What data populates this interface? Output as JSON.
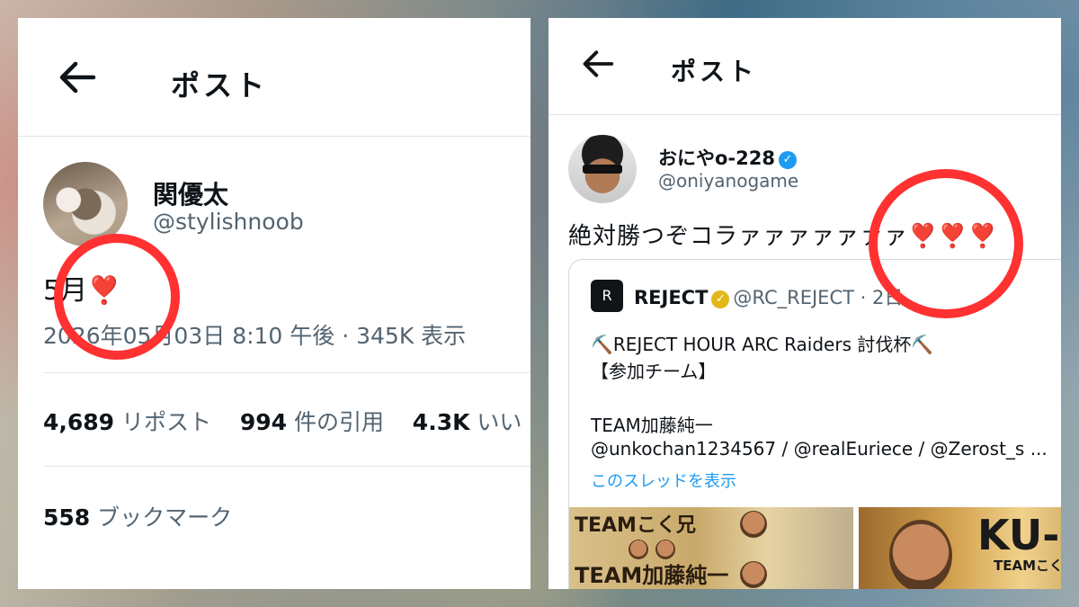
{
  "left_post": {
    "header_title": "ポスト",
    "author_name": "関優太",
    "author_handle": "@stylishnoob",
    "text": "5月",
    "emoji": "❣️",
    "meta": "2026年05月03日 8:10 午後 · 345K 表示",
    "stats": {
      "reposts_count": "4,689",
      "reposts_label": "リポスト",
      "quotes_count": "994",
      "quotes_label": "件の引用",
      "likes_count": "4.3K",
      "likes_label": "いい"
    },
    "bookmarks": {
      "count": "558",
      "label": "ブックマーク"
    }
  },
  "right_post": {
    "header_title": "ポスト",
    "author_name": "おにやo-228",
    "author_handle": "@oniyanogame",
    "text": "絶対勝つぞコラァァァァァァァ",
    "emoji": "❣️❣️❣️",
    "quote": {
      "logo": "R",
      "name": "REJECT",
      "handle_time": "@RC_REJECT · 2日",
      "line1": "⛏️REJECT HOUR ARC Raiders 討伐杯⛏️",
      "line2": "【参加チーム】",
      "line3": "TEAM加藤純一",
      "line4": "@unkochan1234567 / @realEuriece / @Zerost_s ...",
      "thread_link": "このスレッドを表示",
      "thumb1_line1": "TEAMこく兄",
      "thumb1_line2": "TEAM加藤純一",
      "thumb2_line1": "KU-",
      "thumb2_line2": "TEAMこく兄"
    }
  },
  "colors": {
    "highlight_ring": "#ff3131",
    "heart": "#ff1f6b",
    "link": "#1d9bf0",
    "secondary_text": "#536471"
  }
}
